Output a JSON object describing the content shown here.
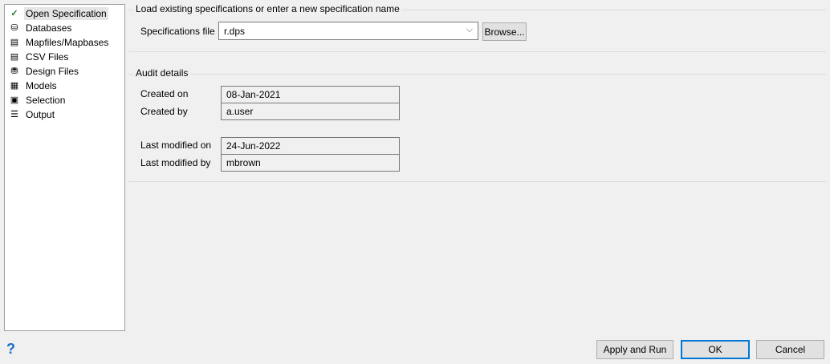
{
  "sidebar": {
    "items": [
      {
        "label": "Open Specification",
        "icon": "open-specification-icon"
      },
      {
        "label": "Databases",
        "icon": "database-icon"
      },
      {
        "label": "Mapfiles/Mapbases",
        "icon": "mapfile-icon"
      },
      {
        "label": "CSV Files",
        "icon": "csv-file-icon"
      },
      {
        "label": "Design Files",
        "icon": "design-file-icon"
      },
      {
        "label": "Models",
        "icon": "models-icon"
      },
      {
        "label": "Selection",
        "icon": "selection-icon"
      },
      {
        "label": "Output",
        "icon": "output-icon"
      }
    ]
  },
  "spec": {
    "legend": "Load existing specifications or enter a new specification name",
    "label": "Specifications file",
    "value": "r.dps",
    "browse": "Browse..."
  },
  "audit": {
    "legend": "Audit details",
    "created_on_label": "Created on",
    "created_on": "08-Jan-2021",
    "created_by_label": "Created by",
    "created_by": "a.user",
    "modified_on_label": "Last modified on",
    "modified_on": "24-Jun-2022",
    "modified_by_label": "Last modified by",
    "modified_by": "mbrown"
  },
  "footer": {
    "help": "?",
    "apply": "Apply and Run",
    "ok": "OK",
    "cancel": "Cancel"
  },
  "colors": {
    "accent": "#0078d7",
    "help": "#1a6fc4"
  }
}
